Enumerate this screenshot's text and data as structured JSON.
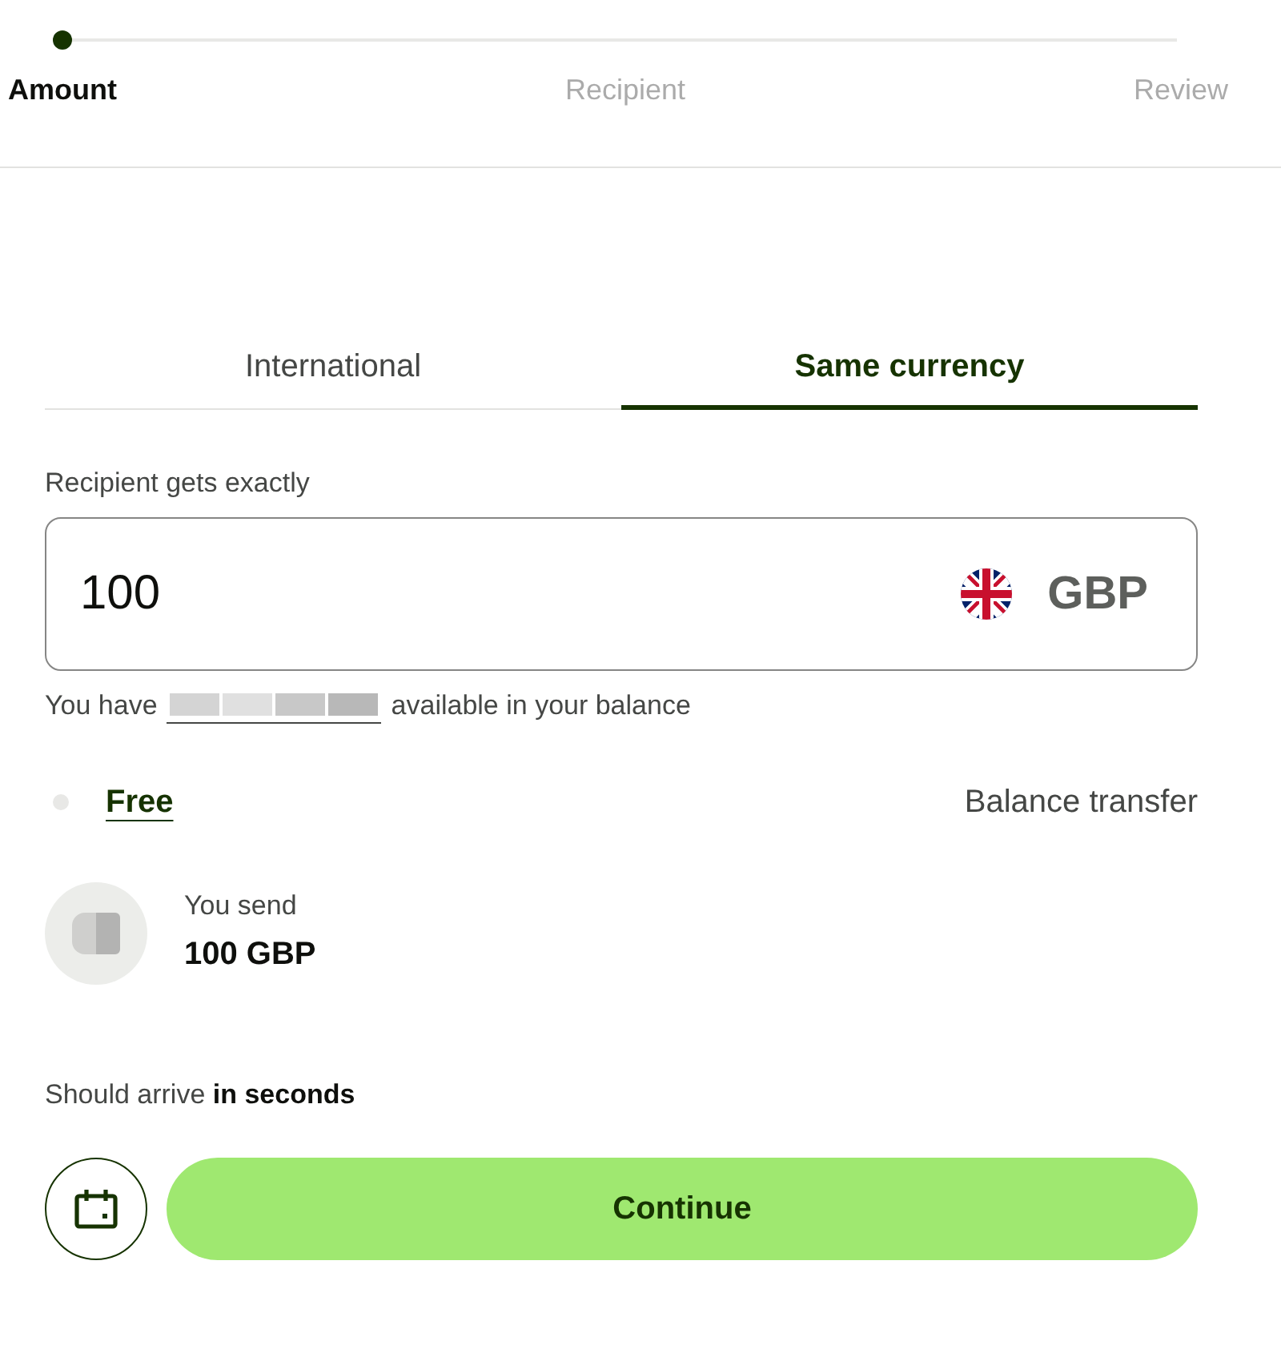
{
  "stepper": {
    "steps": [
      {
        "label": "Amount",
        "selected": true
      },
      {
        "label": "Recipient",
        "selected": false
      },
      {
        "label": "Review",
        "selected": false
      }
    ]
  },
  "tabs": [
    {
      "label": "International",
      "selected": false
    },
    {
      "label": "Same currency",
      "selected": true
    }
  ],
  "amount_field": {
    "label": "Recipient gets exactly",
    "value": "100",
    "currency": "GBP"
  },
  "balance_note": {
    "before": "You have",
    "after": "available in your balance"
  },
  "fee": {
    "label": "Free",
    "method": "Balance transfer"
  },
  "summary": {
    "label": "You send",
    "amount": "100 GBP"
  },
  "arrival": "Should arrive **in seconds**",
  "primary_button": "Continue"
}
